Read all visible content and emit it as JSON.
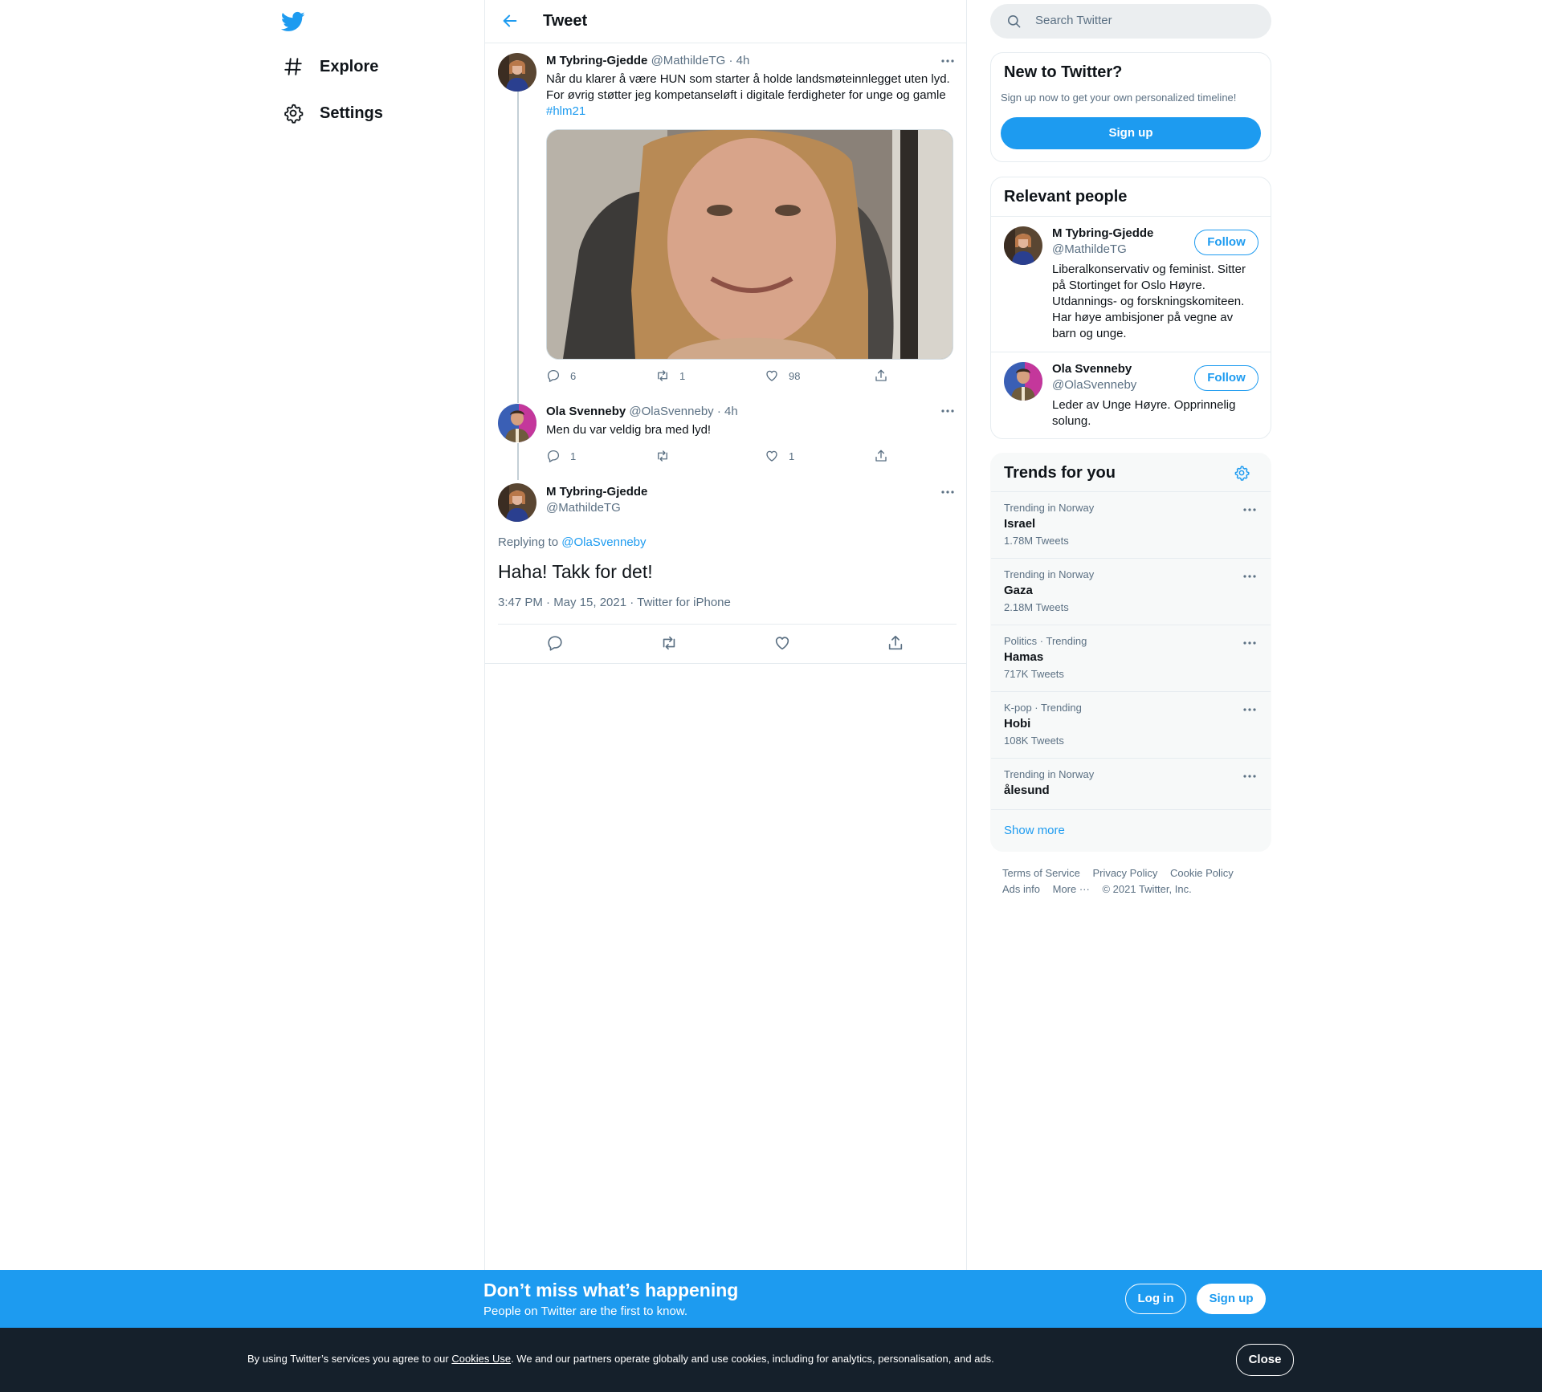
{
  "nav": {
    "items": [
      {
        "label": "Explore",
        "icon": "hashtag-icon"
      },
      {
        "label": "Settings",
        "icon": "gear-icon"
      }
    ]
  },
  "header": {
    "title": "Tweet"
  },
  "thread": [
    {
      "name": "M Tybring-Gjedde",
      "handle": "@MathildeTG",
      "time": "· 4h",
      "text_line1": "Når du klarer å være HUN som starter å holde landsmøteinnlegget uten lyd.",
      "text_line2": "For øvrig støtter jeg kompetanseløft i digitale ferdigheter for unge og gamle",
      "hashtag": "#hlm21",
      "reply_count": "6",
      "retweet_count": "1",
      "like_count": "98"
    },
    {
      "name": "Ola Svenneby",
      "handle": "@OlaSvenneby",
      "time": "· 4h",
      "text": "Men du var veldig bra med lyd!",
      "reply_count": "1",
      "retweet_count": "",
      "like_count": "1"
    }
  ],
  "main_tweet": {
    "name": "M Tybring-Gjedde",
    "handle": "@MathildeTG",
    "replying_prefix": "Replying to",
    "replying_to": "@OlaSvenneby",
    "text": "Haha! Takk for det!",
    "timestamp": "3:47 PM · May 15, 2021 · Twitter for iPhone"
  },
  "search": {
    "placeholder": "Search Twitter"
  },
  "new_to_twitter": {
    "title": "New to Twitter?",
    "subtitle": "Sign up now to get your own personalized timeline!",
    "button": "Sign up"
  },
  "relevant_people": {
    "title": "Relevant people",
    "people": [
      {
        "name": "M Tybring-Gjedde",
        "handle": "@MathildeTG",
        "bio": "Liberalkonservativ og feminist. Sitter på Stortinget for Oslo Høyre. Utdannings- og forskningskomiteen. Har høye ambisjoner på vegne av barn og unge.",
        "follow": "Follow"
      },
      {
        "name": "Ola Svenneby",
        "handle": "@OlaSvenneby",
        "bio": "Leder av Unge Høyre. Opprinnelig solung.",
        "follow": "Follow"
      }
    ]
  },
  "trends": {
    "title": "Trends for you",
    "items": [
      {
        "context": "Trending in Norway",
        "name": "Israel",
        "count": "1.78M Tweets"
      },
      {
        "context": "Trending in Norway",
        "name": "Gaza",
        "count": "2.18M Tweets"
      },
      {
        "context": "Politics · Trending",
        "name": "Hamas",
        "count": "717K Tweets"
      },
      {
        "context": "K-pop · Trending",
        "name": "Hobi",
        "count": "108K Tweets"
      },
      {
        "context": "Trending in Norway",
        "name": "ålesund",
        "count": ""
      }
    ],
    "show_more": "Show more"
  },
  "footer": {
    "links": [
      "Terms of Service",
      "Privacy Policy",
      "Cookie Policy",
      "Ads info",
      "More ···"
    ],
    "copyright": "© 2021 Twitter, Inc."
  },
  "bottom_bar": {
    "title": "Don’t miss what’s happening",
    "subtitle": "People on Twitter are the first to know.",
    "login": "Log in",
    "signup": "Sign up"
  },
  "cookie_bar": {
    "text_before": "By using Twitter’s services you agree to our ",
    "link": "Cookies Use",
    "text_after": ". We and our partners operate globally and use cookies, including for analytics, personalisation, and ads.",
    "close": "Close"
  },
  "colors": {
    "accent": "#1d9bf0",
    "muted": "#5b7083",
    "cookie_bg": "#15202b"
  }
}
